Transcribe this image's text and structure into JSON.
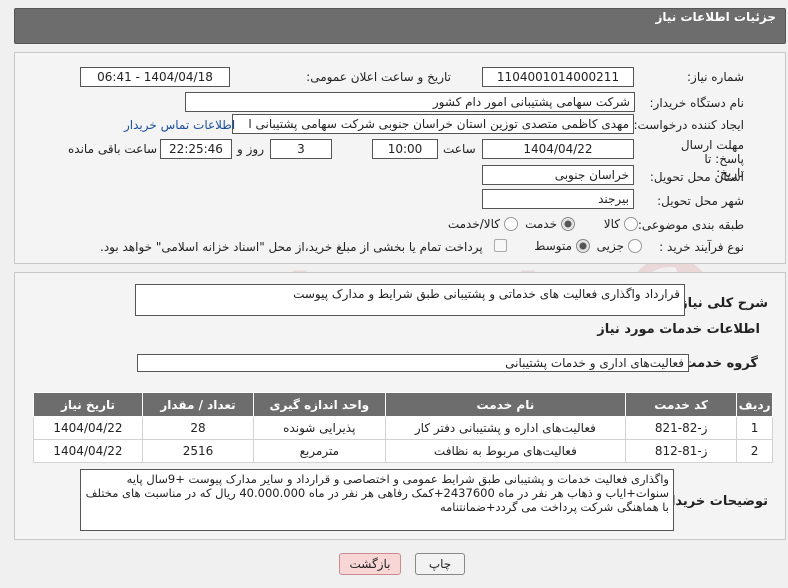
{
  "header": {
    "title": "جزئیات اطلاعات نیاز"
  },
  "fields": {
    "need_number_label": "شماره نیاز:",
    "need_number": "1104001014000211",
    "announce_label": "تاریخ و ساعت اعلان عمومی:",
    "announce_value": "1404/04/18 - 06:41",
    "buyer_label": "نام دستگاه خریدار:",
    "buyer_value": "شرکت سهامی پشتیبانی امور دام کشور",
    "creator_label": "ایجاد کننده درخواست:",
    "creator_value": "مهدی کاظمی متصدی توزین استان خراسان جنوبی شرکت سهامی پشتیبانی ا",
    "contact_link": "اطلاعات تماس خریدار",
    "deadline_label": "مهلت ارسال پاسخ: تا تاریخ:",
    "deadline_date": "1404/04/22",
    "time_label": "ساعت",
    "deadline_time": "10:00",
    "days_value": "3",
    "days_label": "روز و",
    "remaining_value": "22:25:46",
    "remaining_label": "ساعت باقی مانده",
    "province_label": "استان محل تحویل:",
    "province_value": "خراسان جنوبی",
    "city_label": "شهر محل تحویل:",
    "city_value": "بیرجند",
    "category_label": "طبقه بندی موضوعی:",
    "category_options": [
      "کالا",
      "خدمت",
      "کالا/خدمت"
    ],
    "category_selected": 1,
    "process_label": "نوع فرآیند خرید :",
    "process_options": [
      "جزیی",
      "متوسط"
    ],
    "process_selected": 1,
    "payment_note": "پرداخت تمام یا بخشی از مبلغ خرید،از محل \"اسناد خزانه اسلامی\" خواهد بود."
  },
  "description": {
    "label": "شرح کلی نیاز:",
    "value": "قرارداد واگذاری فعالیت های خدماتی و پشتیبانی طبق شرایط و مدارک پیوست"
  },
  "services": {
    "section_title": "اطلاعات خدمات مورد نیاز",
    "group_label": "گروه خدمت:",
    "group_value": "فعالیت‌های اداری و خدمات پشتیبانی",
    "columns": [
      "ردیف",
      "کد خدمت",
      "نام خدمت",
      "واحد اندازه گیری",
      "تعداد / مقدار",
      "تاریخ نیاز"
    ],
    "rows": [
      [
        "1",
        "ز-82-821",
        "فعالیت‌های اداره و پشتیبانی دفتر کار",
        "پذیرایی شونده",
        "28",
        "1404/04/22"
      ],
      [
        "2",
        "ز-81-812",
        "فعالیت‌های مربوط به نظافت",
        "مترمربع",
        "2516",
        "1404/04/22"
      ]
    ]
  },
  "buyer_notes": {
    "label": "توضیحات خریدار:",
    "value": "واگذاری فعالیت خدمات و پشتیبانی طبق شرایط عمومی و اختصاصی و قرارداد و سایر مدارک پیوست +9سال پایه سنوات+ایاب و ذهاب هر نفر در ماه 2437600+کمک رفاهی هر نفر در ماه 40.000.000 ریال که در مناسبت های مختلف با هماهنگی شرکت پرداخت می گردد+ضمانتنامه"
  },
  "buttons": {
    "print": "چاپ",
    "back": "بازگشت"
  },
  "colors": {
    "header_bg": "#6d6d6d",
    "link": "#1a4f9c",
    "back_btn_bg": "#f9d6d6"
  }
}
